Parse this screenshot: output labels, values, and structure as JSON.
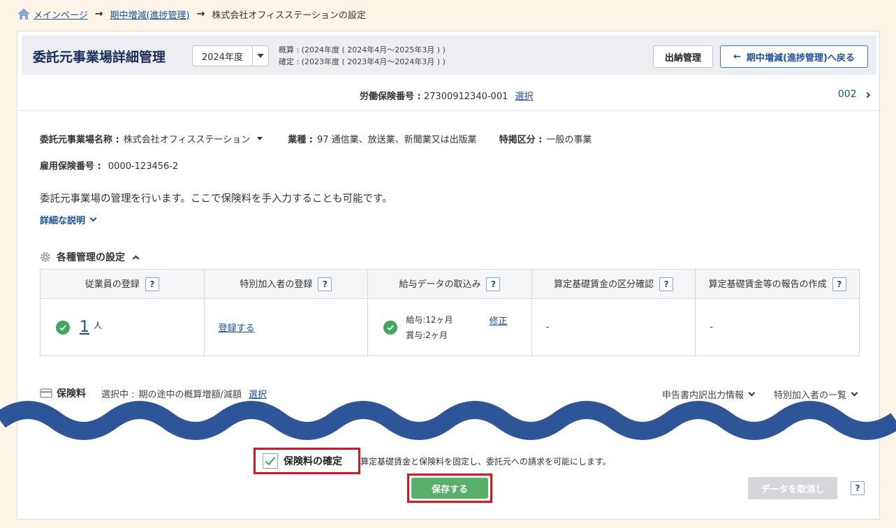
{
  "breadcrumb": {
    "home": "メインページ",
    "mid": "期中増減(進捗管理)",
    "current": "株式会社オフィスステーションの設定"
  },
  "header": {
    "title": "委託元事業場詳細管理",
    "year_value": "2024年度",
    "period_estimate": "概算 : (2024年度 ( 2024年4月～2025年3月 ) )",
    "period_final": "確定 : (2023年度 ( 2023年4月～2024年3月 ) )",
    "shuno_label": "出納管理",
    "back_label": "期中増減(進捗管理)へ戻る",
    "back_arrow": "←"
  },
  "insurance_number": {
    "label": "労働保険番号 :",
    "value": "27300912340-001",
    "select_link": "選択",
    "next_label": "002"
  },
  "info": {
    "name_label": "委託元事業場名称 :",
    "name_value": "株式会社オフィスステーション",
    "industry_label": "業種 :",
    "industry_value": "97  通信業、放送業、新聞業又は出版業",
    "special_label": "特掲区分 :",
    "special_value": "一般の事業",
    "employment_label": "雇用保険番号 :",
    "employment_value": "0000-123456-2"
  },
  "description": "委託元事業場の管理を行います。ここで保険料を手入力することも可能です。",
  "detail_link": "詳細な説明",
  "settings": {
    "title": "各種管理の設定",
    "help_glyph": "?",
    "columns": [
      "従業員の登録",
      "特別加入者の登録",
      "給与データの取込み",
      "算定基礎賃金の区分確認",
      "算定基礎賃金等の報告の作成"
    ],
    "employee_count": "1",
    "employee_unit": "人",
    "register_link": "登録する",
    "salary_line": "給与:12ヶ月",
    "bonus_line": "賞与:2ヶ月",
    "edit_link": "修正",
    "col4_value": "-",
    "col5_value": "-"
  },
  "insurance": {
    "title": "保険料",
    "selected_prefix": "選択中 :",
    "selected_value": "期の途中の概算増額/減額",
    "select_link": "選択",
    "report_info": "申告書内訳出力情報",
    "special_list": "特別加入者の一覧"
  },
  "footer": {
    "confirm_label": "保険料の確定",
    "confirm_desc": "算定基礎賃金と保険料を固定し、委託元への請求を可能にします。",
    "save_label": "保存する",
    "cancel_label": "データを取消し",
    "help_glyph": "?"
  },
  "colors": {
    "accent": "#1a4fa0",
    "save": "#58b06a",
    "highlight": "#e0141e",
    "wave": "#2d5597"
  }
}
